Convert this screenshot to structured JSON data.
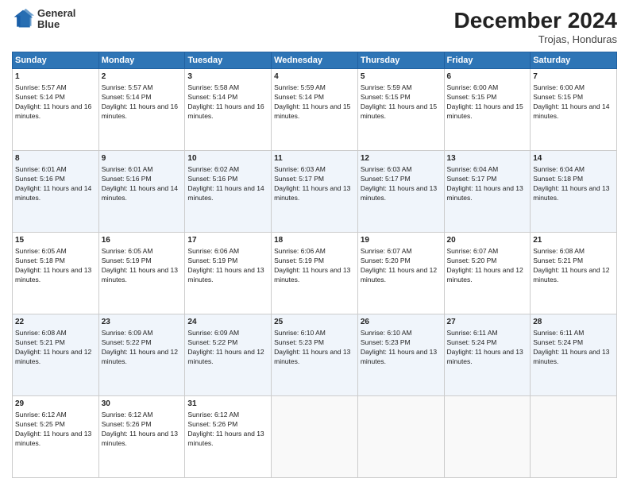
{
  "logo": {
    "line1": "General",
    "line2": "Blue"
  },
  "title": "December 2024",
  "subtitle": "Trojas, Honduras",
  "days_of_week": [
    "Sunday",
    "Monday",
    "Tuesday",
    "Wednesday",
    "Thursday",
    "Friday",
    "Saturday"
  ],
  "weeks": [
    [
      {
        "day": 1,
        "sunrise": "5:57 AM",
        "sunset": "5:14 PM",
        "daylight": "11 hours and 16 minutes."
      },
      {
        "day": 2,
        "sunrise": "5:57 AM",
        "sunset": "5:14 PM",
        "daylight": "11 hours and 16 minutes."
      },
      {
        "day": 3,
        "sunrise": "5:58 AM",
        "sunset": "5:14 PM",
        "daylight": "11 hours and 16 minutes."
      },
      {
        "day": 4,
        "sunrise": "5:59 AM",
        "sunset": "5:14 PM",
        "daylight": "11 hours and 15 minutes."
      },
      {
        "day": 5,
        "sunrise": "5:59 AM",
        "sunset": "5:15 PM",
        "daylight": "11 hours and 15 minutes."
      },
      {
        "day": 6,
        "sunrise": "6:00 AM",
        "sunset": "5:15 PM",
        "daylight": "11 hours and 15 minutes."
      },
      {
        "day": 7,
        "sunrise": "6:00 AM",
        "sunset": "5:15 PM",
        "daylight": "11 hours and 14 minutes."
      }
    ],
    [
      {
        "day": 8,
        "sunrise": "6:01 AM",
        "sunset": "5:16 PM",
        "daylight": "11 hours and 14 minutes."
      },
      {
        "day": 9,
        "sunrise": "6:01 AM",
        "sunset": "5:16 PM",
        "daylight": "11 hours and 14 minutes."
      },
      {
        "day": 10,
        "sunrise": "6:02 AM",
        "sunset": "5:16 PM",
        "daylight": "11 hours and 14 minutes."
      },
      {
        "day": 11,
        "sunrise": "6:03 AM",
        "sunset": "5:17 PM",
        "daylight": "11 hours and 13 minutes."
      },
      {
        "day": 12,
        "sunrise": "6:03 AM",
        "sunset": "5:17 PM",
        "daylight": "11 hours and 13 minutes."
      },
      {
        "day": 13,
        "sunrise": "6:04 AM",
        "sunset": "5:17 PM",
        "daylight": "11 hours and 13 minutes."
      },
      {
        "day": 14,
        "sunrise": "6:04 AM",
        "sunset": "5:18 PM",
        "daylight": "11 hours and 13 minutes."
      }
    ],
    [
      {
        "day": 15,
        "sunrise": "6:05 AM",
        "sunset": "5:18 PM",
        "daylight": "11 hours and 13 minutes."
      },
      {
        "day": 16,
        "sunrise": "6:05 AM",
        "sunset": "5:19 PM",
        "daylight": "11 hours and 13 minutes."
      },
      {
        "day": 17,
        "sunrise": "6:06 AM",
        "sunset": "5:19 PM",
        "daylight": "11 hours and 13 minutes."
      },
      {
        "day": 18,
        "sunrise": "6:06 AM",
        "sunset": "5:19 PM",
        "daylight": "11 hours and 13 minutes."
      },
      {
        "day": 19,
        "sunrise": "6:07 AM",
        "sunset": "5:20 PM",
        "daylight": "11 hours and 12 minutes."
      },
      {
        "day": 20,
        "sunrise": "6:07 AM",
        "sunset": "5:20 PM",
        "daylight": "11 hours and 12 minutes."
      },
      {
        "day": 21,
        "sunrise": "6:08 AM",
        "sunset": "5:21 PM",
        "daylight": "11 hours and 12 minutes."
      }
    ],
    [
      {
        "day": 22,
        "sunrise": "6:08 AM",
        "sunset": "5:21 PM",
        "daylight": "11 hours and 12 minutes."
      },
      {
        "day": 23,
        "sunrise": "6:09 AM",
        "sunset": "5:22 PM",
        "daylight": "11 hours and 12 minutes."
      },
      {
        "day": 24,
        "sunrise": "6:09 AM",
        "sunset": "5:22 PM",
        "daylight": "11 hours and 12 minutes."
      },
      {
        "day": 25,
        "sunrise": "6:10 AM",
        "sunset": "5:23 PM",
        "daylight": "11 hours and 13 minutes."
      },
      {
        "day": 26,
        "sunrise": "6:10 AM",
        "sunset": "5:23 PM",
        "daylight": "11 hours and 13 minutes."
      },
      {
        "day": 27,
        "sunrise": "6:11 AM",
        "sunset": "5:24 PM",
        "daylight": "11 hours and 13 minutes."
      },
      {
        "day": 28,
        "sunrise": "6:11 AM",
        "sunset": "5:24 PM",
        "daylight": "11 hours and 13 minutes."
      }
    ],
    [
      {
        "day": 29,
        "sunrise": "6:12 AM",
        "sunset": "5:25 PM",
        "daylight": "11 hours and 13 minutes."
      },
      {
        "day": 30,
        "sunrise": "6:12 AM",
        "sunset": "5:26 PM",
        "daylight": "11 hours and 13 minutes."
      },
      {
        "day": 31,
        "sunrise": "6:12 AM",
        "sunset": "5:26 PM",
        "daylight": "11 hours and 13 minutes."
      },
      null,
      null,
      null,
      null
    ]
  ]
}
